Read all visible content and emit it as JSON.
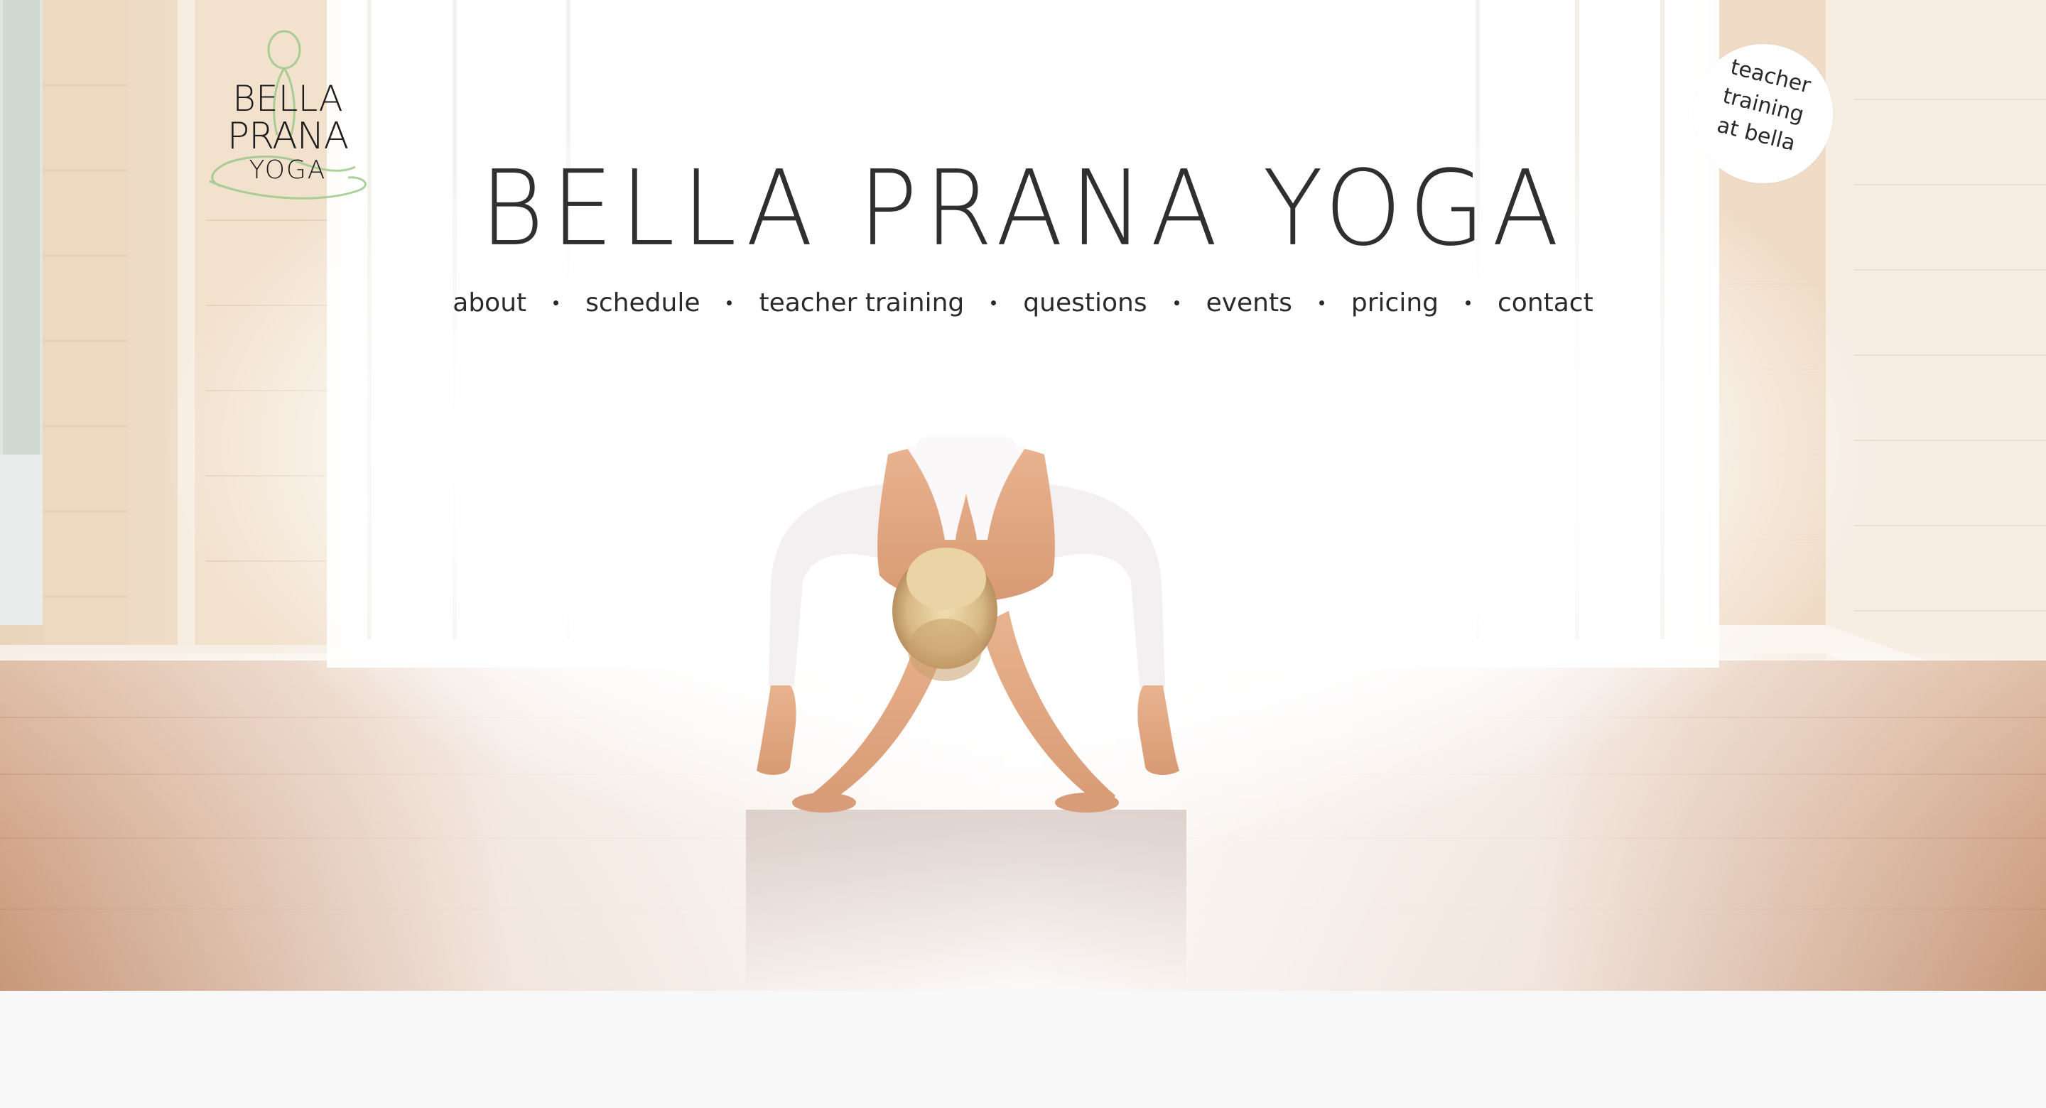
{
  "site": {
    "title": "BELLA PRANA YOGA"
  },
  "logo": {
    "line1": "BELLA",
    "line2": "PRANA",
    "line3": "YOGA",
    "accent_color": "#9cc98a"
  },
  "nav": {
    "items": [
      {
        "label": "about"
      },
      {
        "label": "schedule"
      },
      {
        "label": "teacher training"
      },
      {
        "label": "questions"
      },
      {
        "label": "events"
      },
      {
        "label": "pricing"
      },
      {
        "label": "contact"
      }
    ]
  },
  "badge": {
    "line1": "teacher",
    "line2": "training",
    "line3": "at bella"
  },
  "hero": {
    "image": "yoga-pose-photo",
    "colors": {
      "wall": "#efdcc6",
      "floor": "#c89474",
      "window_light": "#ffffff"
    }
  }
}
